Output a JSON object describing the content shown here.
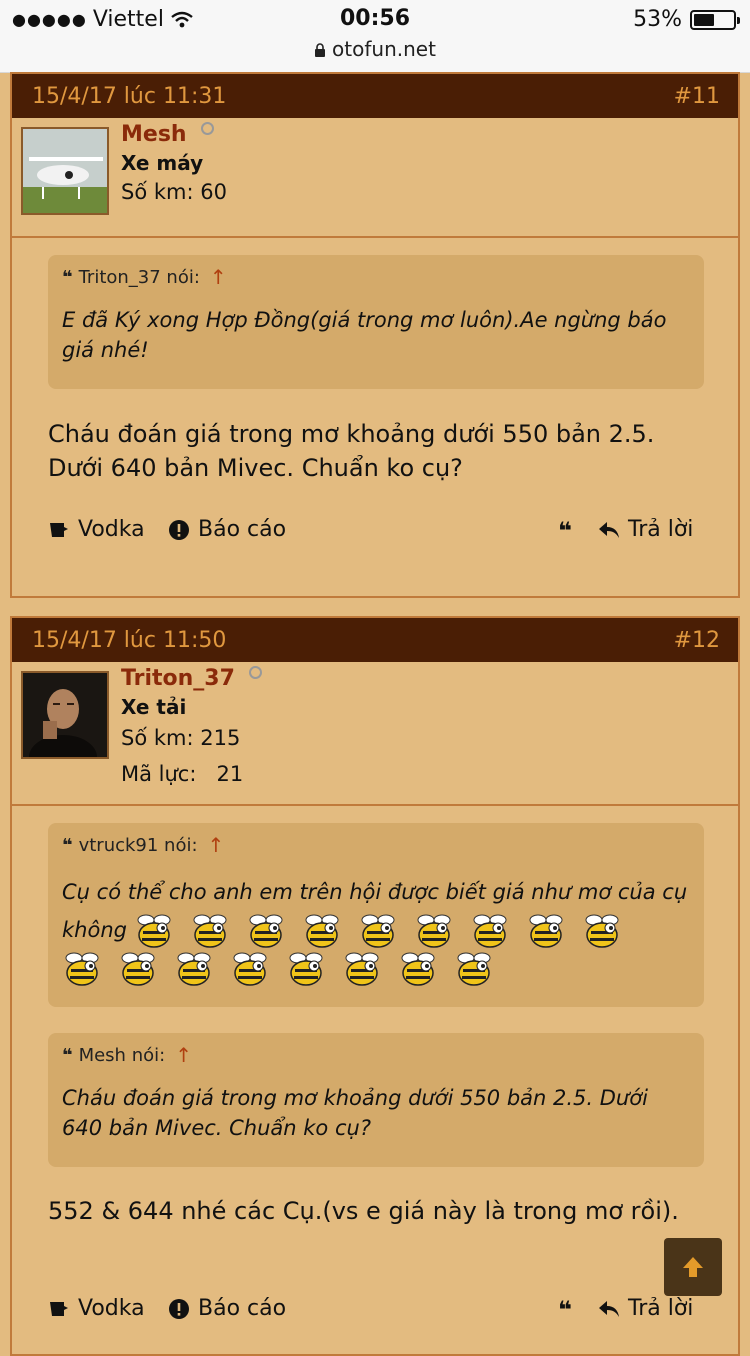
{
  "status_bar": {
    "carrier": "Viettel",
    "time": "00:56",
    "battery_percent": "53%",
    "battery_level": 0.53,
    "url": "otofun.net"
  },
  "posts": [
    {
      "date": "15/4/17 lúc 11:31",
      "number": "#11",
      "username": "Mesh",
      "user_title": "Xe máy",
      "stat_km_label": "Số km:",
      "stat_km_value": "60",
      "quotes": [
        {
          "author": "Triton_37 nói:",
          "text": "E đã Ký xong Hợp Đồng(giá trong mơ luôn).Ae ngừng báo giá nhé!"
        }
      ],
      "message": "Cháu đoán giá trong mơ khoảng dưới 550 bản 2.5. Dưới 640 bản Mivec. Chuẩn ko cụ?",
      "actions": {
        "like": "Vodka",
        "report": "Báo cáo",
        "reply": "Trả lời"
      }
    },
    {
      "date": "15/4/17 lúc 11:50",
      "number": "#12",
      "username": "Triton_37",
      "user_title": "Xe tải",
      "stat_km_label": "Số km:",
      "stat_km_value": "215",
      "stat_hp_label": "Mã lực:",
      "stat_hp_value": "21",
      "quotes": [
        {
          "author": "vtruck91 nói:",
          "text": "Cụ có thể cho anh em trên hội được biết giá như mơ của cụ không",
          "emoji_count": 17
        },
        {
          "author": "Mesh nói:",
          "text": "Cháu đoán giá trong mơ khoảng dưới 550 bản 2.5. Dưới 640 bản Mivec. Chuẩn ko cụ?"
        }
      ],
      "message": "552 & 644 nhé các Cụ.(vs e giá này là trong mơ rồi).",
      "actions": {
        "like": "Vodka",
        "report": "Báo cáo",
        "reply": "Trả lời"
      }
    }
  ],
  "icons": {
    "like": "vodka-icon",
    "report": "exclamation-circle-icon",
    "quote": "quote-icon",
    "reply": "reply-arrow-icon",
    "scroll_top": "arrow-up-icon",
    "emoji": "bee-emoji-icon"
  },
  "colors": {
    "background": "#e3bb80",
    "post_header": "#4a1e05",
    "post_header_text": "#e0983f",
    "username": "#8a2a0a",
    "quote_bg": "#d4aa6a",
    "border": "#c07a3b"
  }
}
